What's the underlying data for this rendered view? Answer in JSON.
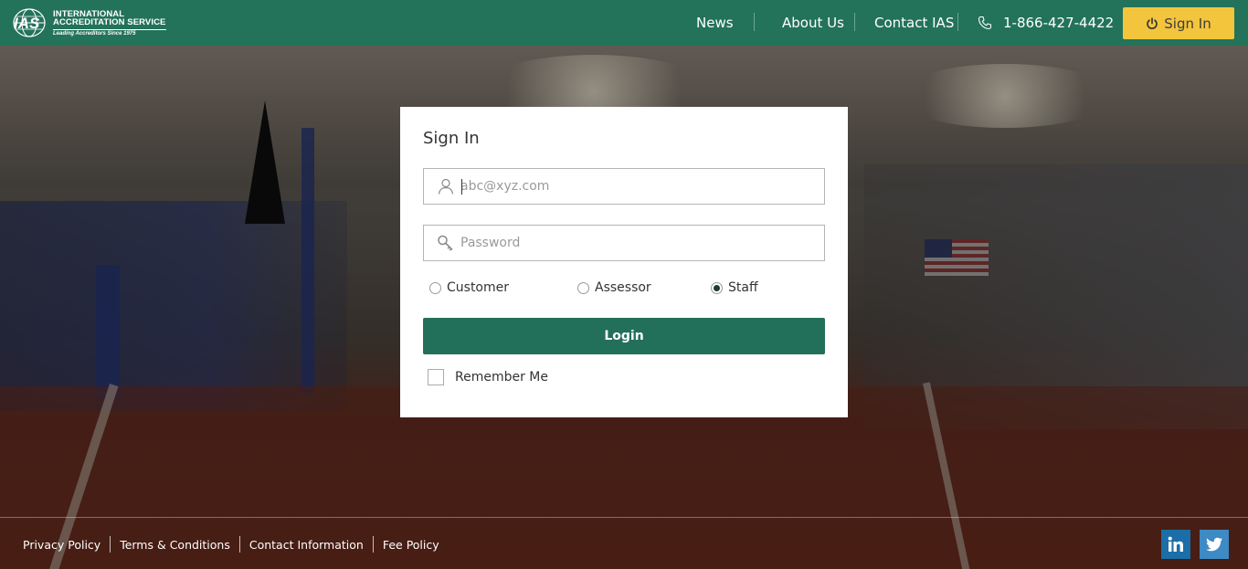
{
  "header": {
    "logo": {
      "line1": "INTERNATIONAL",
      "line2": "ACCREDITATION SERVICE",
      "tagline": "Leading Accreditors Since 1975",
      "mark": "IAS"
    },
    "nav": [
      {
        "label": "News",
        "name": "nav-news"
      },
      {
        "label": "About Us",
        "name": "nav-about-us"
      },
      {
        "label": "Contact IAS",
        "name": "nav-contact-ias"
      }
    ],
    "phone": "1-866-427-4422",
    "signin_label": "Sign In",
    "brand_color": "#23725a",
    "button_color": "#f2c53d"
  },
  "login": {
    "title": "Sign In",
    "email_placeholder": "abc@xyz.com",
    "password_placeholder": "Password",
    "roles": [
      {
        "label": "Customer",
        "checked": false
      },
      {
        "label": "Assessor",
        "checked": false
      },
      {
        "label": "Staff",
        "checked": true
      }
    ],
    "login_label": "Login",
    "remember_label": "Remember Me",
    "remember_checked": false
  },
  "footer": {
    "links": [
      "Privacy Policy",
      "Terms & Conditions",
      "Contact Information",
      "Fee Policy"
    ],
    "social": [
      "linkedin-icon",
      "twitter-icon"
    ]
  }
}
